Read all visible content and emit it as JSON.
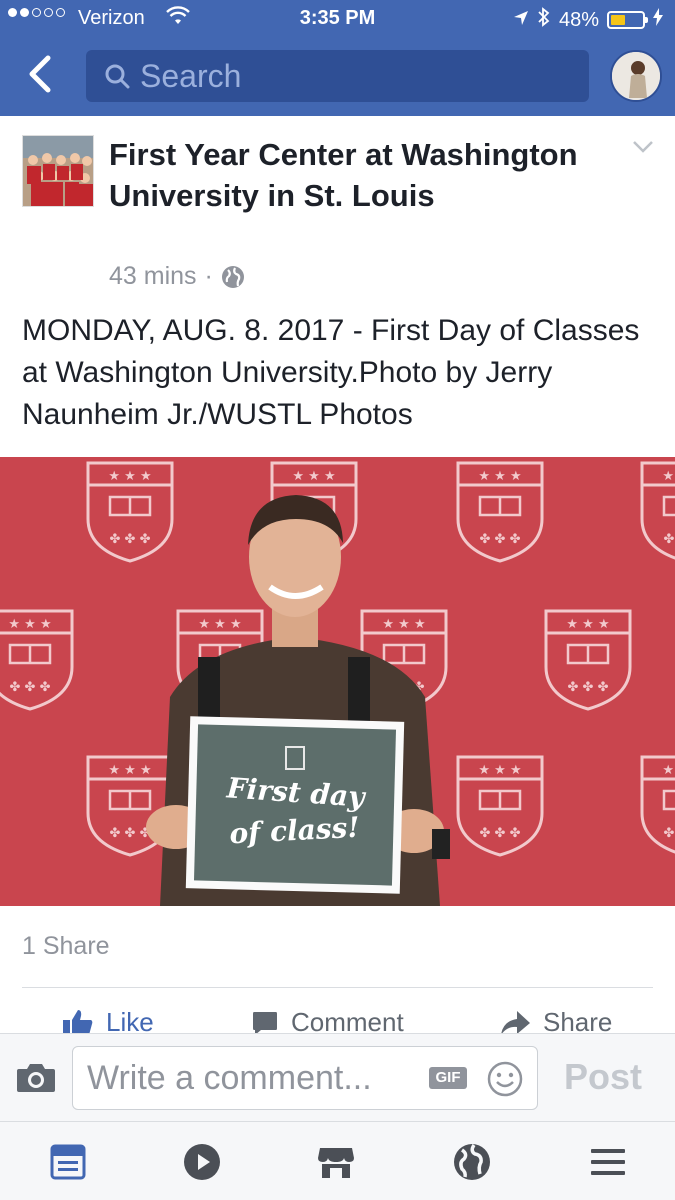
{
  "status_bar": {
    "carrier": "Verizon",
    "time": "3:35 PM",
    "battery": "48%",
    "battery_level": 0.48
  },
  "nav": {
    "search_placeholder": "Search"
  },
  "post": {
    "page_name": "First Year Center at Washington University in St. Louis",
    "timestamp": "43 mins",
    "separator": "·",
    "text": "MONDAY, AUG. 8. 2017 - First Day of Classes at Washington University.Photo by Jerry Naunheim Jr./WUSTL Photos",
    "photo_sign_line1": "First day",
    "photo_sign_line2": "of class!",
    "shares": "1 Share"
  },
  "actions": {
    "like": "Like",
    "comment": "Comment",
    "share": "Share"
  },
  "composer": {
    "placeholder": "Write a comment...",
    "gif": "GIF",
    "post": "Post"
  },
  "colors": {
    "brand": "#4267b2",
    "photo_backdrop": "#c9454e"
  },
  "icons": [
    "back-icon",
    "search-icon",
    "globe-icon",
    "chevron-down-icon",
    "like-icon",
    "comment-icon",
    "share-icon",
    "camera-icon",
    "smile-icon",
    "news-feed-icon",
    "video-icon",
    "marketplace-icon",
    "notifications-globe-icon",
    "menu-icon"
  ]
}
